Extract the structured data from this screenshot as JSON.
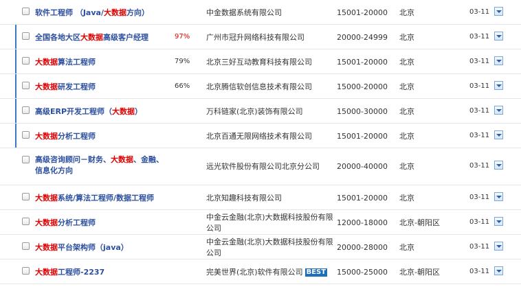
{
  "colors": {
    "title": "#2c4fa0",
    "highlight": "#e00000",
    "accent_bar": "#3a78c9",
    "best_badge": "#1f6fb8"
  },
  "jobs": [
    {
      "title": [
        [
          "软件工程师  （Java/",
          0
        ],
        [
          "大数据",
          1
        ],
        [
          "方向）",
          0
        ]
      ],
      "match": "",
      "company": "中金数据系统有限公司",
      "salary": "15001-20000",
      "location": "北京",
      "date": "03-11"
    },
    {
      "title": [
        [
          "全国各地大区",
          0
        ],
        [
          "大数据",
          1
        ],
        [
          "高级客户经理",
          0
        ]
      ],
      "match": "97%",
      "company": "广州市冠升网络科技有限公司",
      "salary": "20000-24999",
      "location": "北京",
      "date": "03-11"
    },
    {
      "title": [
        [
          "大数据",
          1
        ],
        [
          "算法工程师",
          0
        ]
      ],
      "match": "79%",
      "company": "北京三好互动教育科技有限公司",
      "salary": "15001-20000",
      "location": "北京",
      "date": "03-11"
    },
    {
      "title": [
        [
          "大数据",
          1
        ],
        [
          "研发工程师",
          0
        ]
      ],
      "match": "66%",
      "company": "北京腾信软创信息技术有限公司",
      "salary": "15000-20000",
      "location": "北京",
      "date": "03-11"
    },
    {
      "title": [
        [
          "高级ERP开发工程师（",
          0
        ],
        [
          "大数据",
          1
        ],
        [
          "）",
          0
        ]
      ],
      "match": "",
      "company": "万科链家(北京)装饰有限公司",
      "salary": "15000-30000",
      "location": "北京",
      "date": "03-11"
    },
    {
      "title": [
        [
          "大数据",
          1
        ],
        [
          "分析工程师",
          0
        ]
      ],
      "match": "",
      "company": "北京百通无限网络技术有限公司",
      "salary": "15001-20000",
      "location": "北京",
      "date": "03-11"
    },
    {
      "title": [
        [
          "高级咨询顾问－财务、",
          0
        ],
        [
          "大数据",
          1
        ],
        [
          "、金融、信息化方向",
          0
        ]
      ],
      "match": "",
      "company": "远光软件股份有限公司北京分公司",
      "salary": "20000-40000",
      "location": "北京",
      "date": "03-11"
    },
    {
      "title": [
        [
          "大数据",
          1
        ],
        [
          "系统/算法工程师/数据工程师",
          0
        ]
      ],
      "match": "",
      "company": "北京知趣科技有限公司",
      "salary": "15001-20000",
      "location": "北京",
      "date": "03-11"
    },
    {
      "title": [
        [
          "大数据",
          1
        ],
        [
          "分析工程师",
          0
        ]
      ],
      "match": "",
      "company": "中金云金融(北京)大数据科技股份有限公司",
      "salary": "12000-18000",
      "location": "北京-朝阳区",
      "date": "03-11"
    },
    {
      "title": [
        [
          "大数据",
          1
        ],
        [
          "平台架构师（java）",
          0
        ]
      ],
      "match": "",
      "company": "中金云金融(北京)大数据科技股份有限公司",
      "salary": "20000-28000",
      "location": "北京",
      "date": "03-11"
    },
    {
      "title": [
        [
          "大数据",
          1
        ],
        [
          "工程师-2237",
          0
        ]
      ],
      "match": "",
      "company": "完美世界(北京)软件有限公司",
      "badge": "BEST",
      "salary": "15000-25000",
      "location": "北京-朝阳区",
      "date": "03-11"
    }
  ]
}
